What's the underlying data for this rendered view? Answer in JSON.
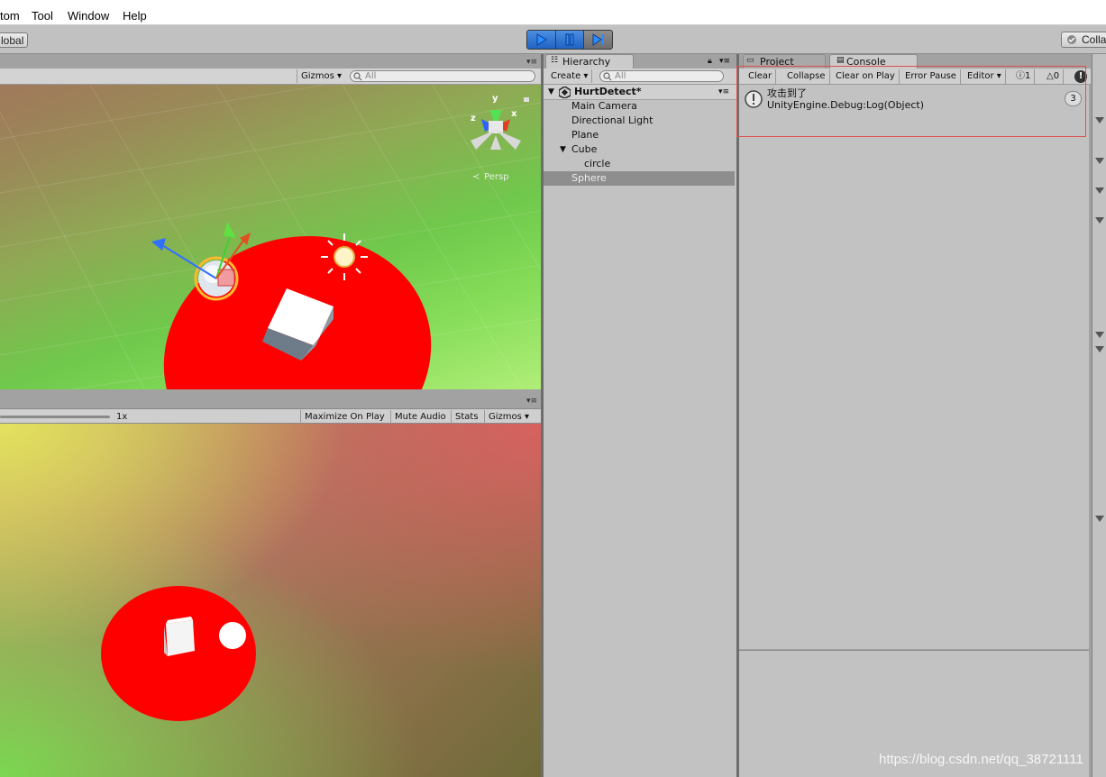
{
  "menu": [
    "tom",
    "Tool",
    "Window",
    "Help"
  ],
  "toolbar": {
    "global_label": "lobal",
    "collab_label": "Colla"
  },
  "scene": {
    "gizmos_label": "Gizmos",
    "search_placeholder": "All",
    "axis_labels": {
      "y": "y",
      "x": "x",
      "z": "z"
    },
    "persp_label": "Persp"
  },
  "game": {
    "scale_label": "1x",
    "buttons": [
      "Maximize On Play",
      "Mute Audio",
      "Stats",
      "Gizmos"
    ]
  },
  "hierarchy": {
    "tab_label": "Hierarchy",
    "create_label": "Create",
    "search_placeholder": "All",
    "scene_name": "HurtDetect*",
    "items": [
      {
        "label": "Main Camera"
      },
      {
        "label": "Directional Light"
      },
      {
        "label": "Plane"
      },
      {
        "label": "Cube"
      },
      {
        "label": "circle"
      },
      {
        "label": "Sphere"
      }
    ]
  },
  "console": {
    "tab_label": "Console",
    "project_tab_label": "Project",
    "buttons": [
      "Clear",
      "Collapse",
      "Clear on Play",
      "Error Pause",
      "Editor"
    ],
    "info_count": "1",
    "warn_count": "0",
    "log": {
      "message": "攻击到了",
      "detail": "UnityEngine.Debug:Log(Object)",
      "count": "3"
    }
  },
  "watermark": "https://blog.csdn.net/qq_38721111",
  "colors": {
    "accent_play": "#1f6fdc",
    "highlight_border": "#e05050",
    "plane_red": "#ff0000"
  }
}
